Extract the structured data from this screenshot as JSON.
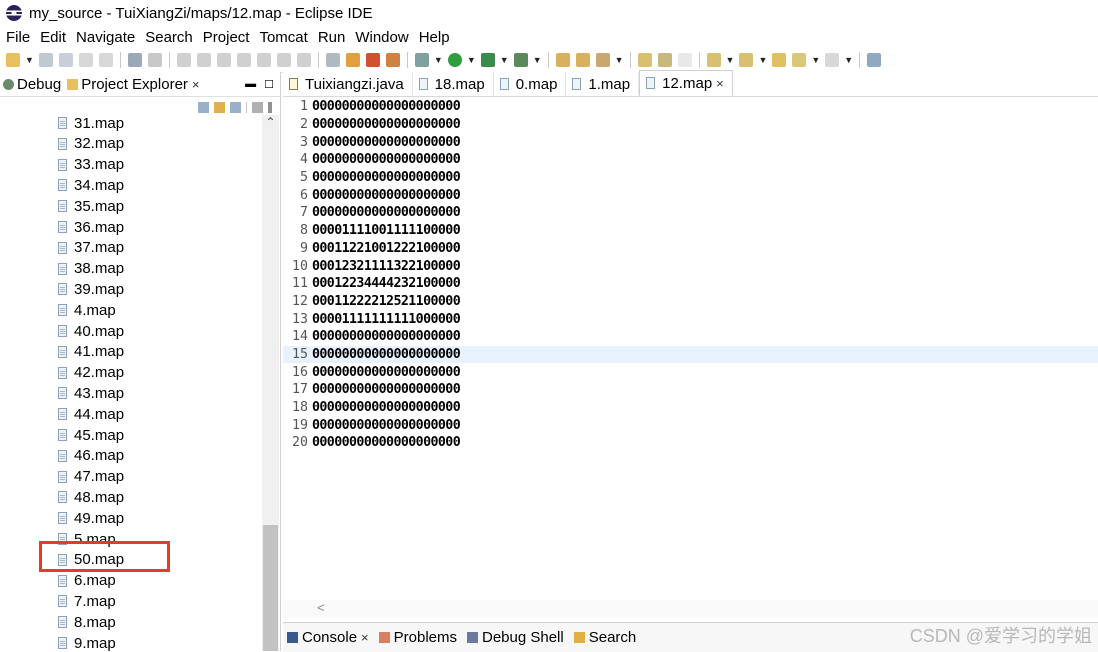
{
  "window": {
    "title": "my_source - TuiXiangZi/maps/12.map - Eclipse IDE"
  },
  "menu": [
    "File",
    "Edit",
    "Navigate",
    "Search",
    "Project",
    "Tomcat",
    "Run",
    "Window",
    "Help"
  ],
  "left_panel": {
    "tabs": [
      {
        "label": "Debug",
        "icon": "debug-icon"
      },
      {
        "label": "Project Explorer",
        "icon": "project-explorer-icon",
        "close": "×"
      }
    ],
    "files": [
      "31.map",
      "32.map",
      "33.map",
      "34.map",
      "35.map",
      "36.map",
      "37.map",
      "38.map",
      "39.map",
      "4.map",
      "40.map",
      "41.map",
      "42.map",
      "43.map",
      "44.map",
      "45.map",
      "46.map",
      "47.map",
      "48.map",
      "49.map",
      "5.map",
      "50.map",
      "6.map",
      "7.map",
      "8.map",
      "9.map"
    ],
    "highlighted_file": "50.map"
  },
  "editor": {
    "tabs": [
      {
        "label": "Tuixiangzi.java",
        "type": "java"
      },
      {
        "label": "18.map",
        "type": "map"
      },
      {
        "label": "0.map",
        "type": "map"
      },
      {
        "label": "1.map",
        "type": "map"
      },
      {
        "label": "12.map",
        "type": "map",
        "active": true,
        "close": "×"
      }
    ],
    "current_line": 15,
    "lines": [
      {
        "n": "1",
        "t": "00000000000000000000"
      },
      {
        "n": "2",
        "t": "00000000000000000000"
      },
      {
        "n": "3",
        "t": "00000000000000000000"
      },
      {
        "n": "4",
        "t": "00000000000000000000"
      },
      {
        "n": "5",
        "t": "00000000000000000000"
      },
      {
        "n": "6",
        "t": "00000000000000000000"
      },
      {
        "n": "7",
        "t": "00000000000000000000"
      },
      {
        "n": "8",
        "t": "00001111001111100000"
      },
      {
        "n": "9",
        "t": "00011221001222100000"
      },
      {
        "n": "10",
        "t": "00012321111322100000"
      },
      {
        "n": "11",
        "t": "00012234444232100000"
      },
      {
        "n": "12",
        "t": "00011222212521100000"
      },
      {
        "n": "13",
        "t": "00001111111111000000"
      },
      {
        "n": "14",
        "t": "00000000000000000000"
      },
      {
        "n": "15",
        "t": "00000000000000000000"
      },
      {
        "n": "16",
        "t": "00000000000000000000"
      },
      {
        "n": "17",
        "t": "00000000000000000000"
      },
      {
        "n": "18",
        "t": "00000000000000000000"
      },
      {
        "n": "19",
        "t": "00000000000000000000"
      },
      {
        "n": "20",
        "t": "00000000000000000000"
      }
    ]
  },
  "bottom_panel": {
    "tabs": [
      {
        "label": "Console",
        "icon": "console-icon",
        "close": "×"
      },
      {
        "label": "Problems",
        "icon": "problems-icon"
      },
      {
        "label": "Debug Shell",
        "icon": "debug-shell-icon"
      },
      {
        "label": "Search",
        "icon": "search-icon"
      }
    ]
  },
  "watermark": "CSDN @爱学习的学姐"
}
